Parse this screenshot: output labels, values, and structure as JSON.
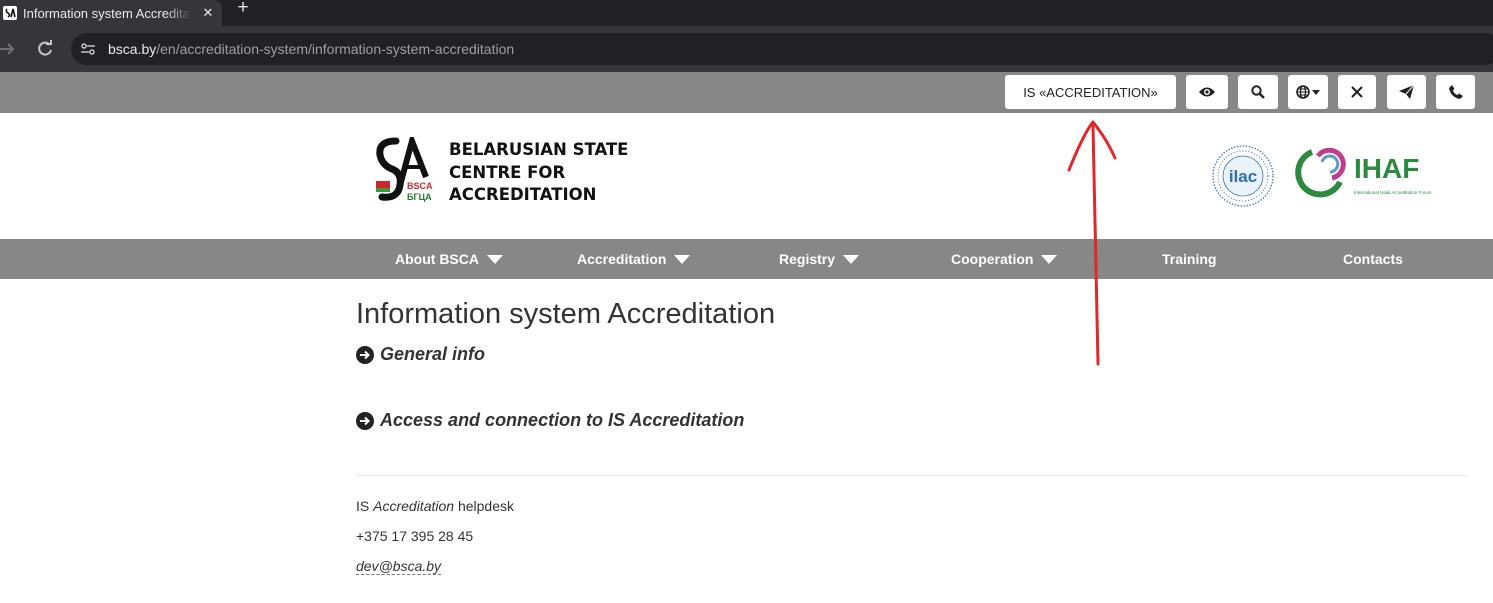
{
  "browser": {
    "tab_title": "Information system Accreditation",
    "tab_close": "✕",
    "new_tab": "+",
    "url_host": "bsca.by",
    "url_path": "/en/accreditation-system/information-system-accreditation"
  },
  "topbar": {
    "is_button_label": "IS «ACCREDITATION»",
    "icons": [
      "eye-icon",
      "search-icon",
      "globe-icon",
      "x-icon",
      "telegram-icon",
      "phone-icon"
    ]
  },
  "header": {
    "org_name_lines": [
      "BELARUSIAN STATE",
      "CENTRE FOR",
      "ACCREDITATION"
    ],
    "logo_text_latin": "BSCA",
    "logo_text_cyrillic": "БГЦА",
    "ilac_logo_text": "ilac",
    "ihaf_logo_text": "IHAF",
    "ihaf_logo_sub": "International Halal Accreditation Forum"
  },
  "nav": {
    "items": [
      {
        "label": "About BSCA",
        "dropdown": true
      },
      {
        "label": "Accreditation",
        "dropdown": true
      },
      {
        "label": "Registry",
        "dropdown": true
      },
      {
        "label": "Cooperation",
        "dropdown": true
      },
      {
        "label": "Training",
        "dropdown": false
      },
      {
        "label": "Contacts",
        "dropdown": false
      }
    ]
  },
  "content": {
    "title": "Information system Accreditation",
    "sections": [
      {
        "label": "General info"
      },
      {
        "label": "Access and connection to IS Accreditation"
      }
    ],
    "helpdesk_prefix": "IS ",
    "helpdesk_italic": "Accreditation",
    "helpdesk_suffix": " helpdesk",
    "phone": "+375 17 395 28 45",
    "email": "dev@bsca.by"
  },
  "colors": {
    "bar_gray": "#878787",
    "chrome_dark": "#202124",
    "chrome_mid": "#35363a",
    "annotation_red": "#e0282a",
    "ilac_blue": "#2f6fb2",
    "ihaf_green": "#2c8a3e"
  }
}
